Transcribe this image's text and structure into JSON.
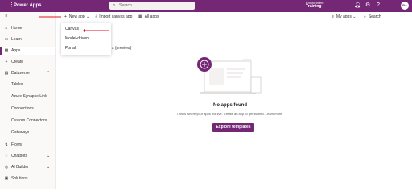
{
  "topbar": {
    "app_name": "Power Apps",
    "search_placeholder": "Search",
    "environment_label": "Environment",
    "environment_value": "Training",
    "avatar_initials": "RA"
  },
  "sidebar": {
    "items": [
      {
        "label": "Home"
      },
      {
        "label": "Learn"
      },
      {
        "label": "Apps"
      },
      {
        "label": "Create"
      },
      {
        "label": "Dataverse"
      },
      {
        "label": "Tables"
      },
      {
        "label": "Azure Synapse Link"
      },
      {
        "label": "Connections"
      },
      {
        "label": "Custom Connectors"
      },
      {
        "label": "Gateways"
      },
      {
        "label": "Flows"
      },
      {
        "label": "Chatbots"
      },
      {
        "label": "AI Builder"
      },
      {
        "label": "Solutions"
      }
    ]
  },
  "commandbar": {
    "new_app": "New app",
    "import_canvas": "Import canvas app",
    "all_apps": "All apps",
    "my_apps": "My apps",
    "search": "Search"
  },
  "dropdown": {
    "items": [
      "Canvas",
      "Model-driven",
      "Portal"
    ]
  },
  "partial_title": "s (preview)",
  "empty_state": {
    "title": "No apps found",
    "subtitle": "This is where your apps will live. Create an app to get started. Learn more",
    "button": "Explore templates"
  },
  "colors": {
    "brand": "#742774",
    "annotation_arrow": "#e81123"
  }
}
